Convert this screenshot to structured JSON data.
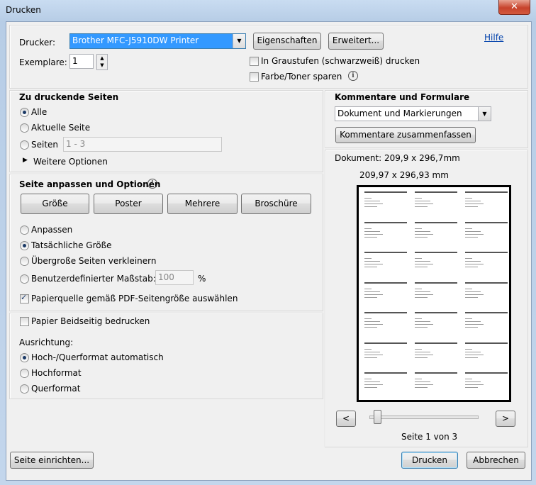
{
  "window": {
    "title": "Drucken",
    "close_glyph": "✕"
  },
  "printer": {
    "label": "Drucker:",
    "selected": "Brother MFC-J5910DW Printer",
    "properties_button": "Eigenschaften",
    "advanced_button": "Erweitert...",
    "help_link": "Hilfe",
    "copies_label": "Exemplare:",
    "copies_value": "1",
    "grayscale_label": "In Graustufen (schwarzweiß) drucken",
    "grayscale_checked": false,
    "save_toner_label": "Farbe/Toner sparen",
    "save_toner_checked": false
  },
  "pages": {
    "title": "Zu druckende Seiten",
    "options": [
      "Alle",
      "Aktuelle Seite",
      "Seiten"
    ],
    "selected": "Alle",
    "range_placeholder": "1 - 3",
    "more_options": "Weitere Optionen"
  },
  "sizing": {
    "title": "Seite anpassen und Optionen",
    "tabs": [
      "Größe",
      "Poster",
      "Mehrere",
      "Broschüre"
    ],
    "options": [
      "Anpassen",
      "Tatsächliche Größe",
      "Übergroße Seiten verkleinern",
      "Benutzerdefinierter Maßstab:"
    ],
    "selected": "Tatsächliche Größe",
    "scale_value": "100",
    "scale_unit": "%",
    "paper_source_label": "Papierquelle gemäß PDF-Seitengröße auswählen",
    "paper_source_checked": true
  },
  "duplex": {
    "label": "Papier Beidseitig bedrucken",
    "checked": false
  },
  "orientation": {
    "title": "Ausrichtung:",
    "options": [
      "Hoch-/Querformat automatisch",
      "Hochformat",
      "Querformat"
    ],
    "selected": "Hoch-/Querformat automatisch"
  },
  "comments": {
    "title": "Kommentare und Formulare",
    "selected": "Dokument und Markierungen",
    "summarize_button": "Kommentare zusammenfassen"
  },
  "preview": {
    "document_size": "Dokument: 209,9 x 296,7mm",
    "page_size": "209,97 x 296,93 mm",
    "page_indicator": "Seite 1 von 3",
    "prev_glyph": "<",
    "next_glyph": ">",
    "current_page": 1,
    "total_pages": 3
  },
  "footer": {
    "page_setup_button": "Seite einrichten...",
    "print_button": "Drucken",
    "cancel_button": "Abbrechen"
  },
  "icons": {
    "info": "info-icon",
    "triangle": "expand-triangle-icon",
    "dropdown": "chevron-down-icon",
    "spin": "spin-arrows-icon"
  }
}
